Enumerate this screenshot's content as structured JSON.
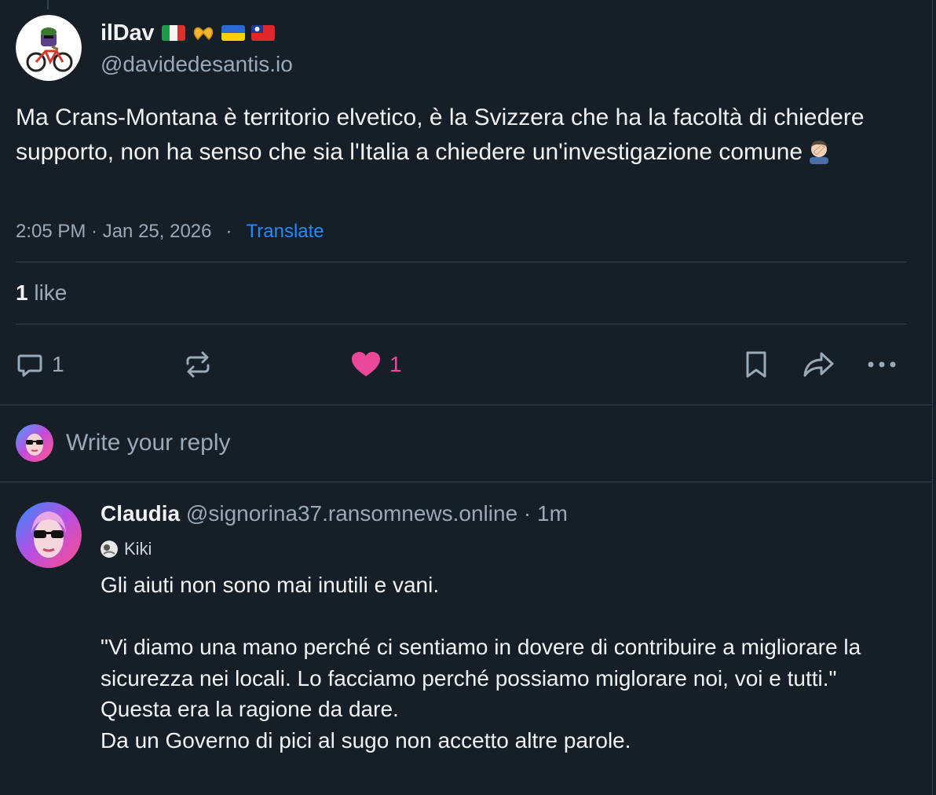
{
  "post": {
    "display_name": "ilDav",
    "flags": [
      "flag-italy-icon",
      "heart-hands-icon",
      "flag-ukraine-icon",
      "flag-taiwan-icon"
    ],
    "handle": "@davidedesantis.io",
    "text": "Ma Crans-Montana è territorio elvetico, è la Svizzera che ha la facoltà di chiedere supporto, non ha senso che sia l'Italia a chiedere un'investigazione comune",
    "text_trailing_icon": "man-facepalming-icon",
    "time": "2:05 PM · Jan 25, 2026",
    "separator": "·",
    "translate_label": "Translate",
    "likes_count": "1",
    "likes_label": "like"
  },
  "actions": {
    "reply_count": "1",
    "like_count": "1",
    "like_color": "#ec4899",
    "icons": [
      "reply-icon",
      "repost-icon",
      "heart-icon",
      "bookmark-icon",
      "share-icon",
      "more-icon"
    ]
  },
  "composer": {
    "placeholder": "Write your reply"
  },
  "reply": {
    "name": "Claudia",
    "meta": "@signorina37.ransomnews.online · 1m",
    "label": "Kiki",
    "lines": [
      "Gli aiuti non sono mai inutili e vani.",
      "",
      "\"Vi diamo una mano perché ci sentiamo in dovere di contribuire a migliorare la sicurezza nei locali. Lo facciamo perché possiamo miglorare noi, voi e tutti.\"",
      "Questa era la ragione da dare.",
      "Da un Governo di pici al sugo non accetto altre parole."
    ]
  },
  "colors": {
    "background": "#161e27",
    "text": "#f1f3f5",
    "muted": "#9aa9b8",
    "link": "#208bfe",
    "border": "#2e4052"
  }
}
